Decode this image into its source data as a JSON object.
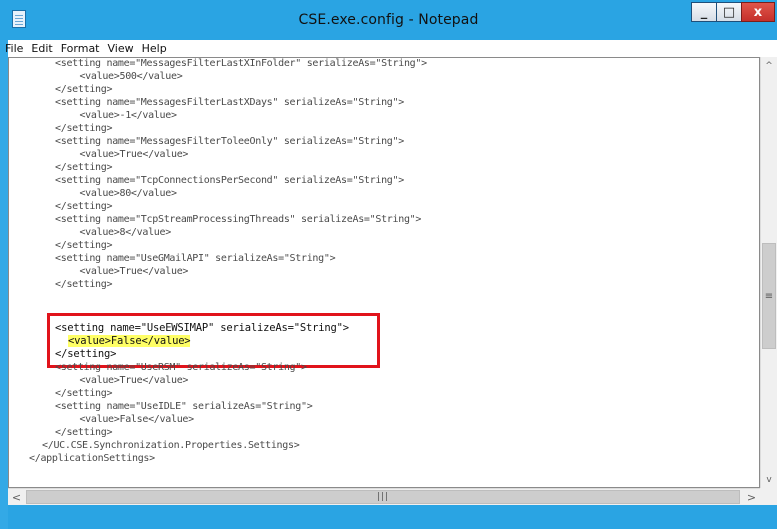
{
  "window": {
    "title": "CSE.exe.config - Notepad",
    "minimize_glyph": "_",
    "maximize_glyph": "□",
    "close_glyph": "x",
    "app_icon": "notepad-icon"
  },
  "menu": [
    {
      "label": "File"
    },
    {
      "label": "Edit"
    },
    {
      "label": "Format"
    },
    {
      "label": "View"
    },
    {
      "label": "Help"
    }
  ],
  "editor": {
    "lines": [
      "<setting name=\"MessagesFilterLastXInFolder\" serializeAs=\"String\">",
      "  <value>500</value>",
      "</setting>",
      "<setting name=\"MessagesFilterLastXDays\" serializeAs=\"String\">",
      "  <value>-1</value>",
      "</setting>",
      "<setting name=\"MessagesFilterToleeOnly\" serializeAs=\"String\">",
      "  <value>True</value>",
      "</setting>",
      "<setting name=\"TcpConnectionsPerSecond\" serializeAs=\"String\">",
      "  <value>80</value>",
      "</setting>",
      "<setting name=\"TcpStreamProcessingThreads\" serializeAs=\"String\">",
      "  <value>8</value>",
      "</setting>",
      "<setting name=\"UseGMailAPI\" serializeAs=\"String\">",
      "  <value>True</value>",
      "</setting>",
      "<setting name=\"UseEWSIMAP\" serializeAs=\"String\">",
      "  <value>False</value>",
      "</setting>",
      "<setting name=\"UseRSM\" serializeAs=\"String\">",
      "  <value>True</value>",
      "</setting>",
      "<setting name=\"UseIDLE\" serializeAs=\"String\">",
      "  <value>False</value>",
      "</setting>",
      "</UC.CSE.Synchronization.Properties.Settings>",
      "</applicationSettings>"
    ],
    "highlighted_value": "<value>False</value>",
    "highlight_color": "#ffff66",
    "callout_color": "#e1131b"
  },
  "scrollbars": {
    "up_glyph": "^",
    "down_glyph": "v",
    "left_glyph": "<",
    "right_glyph": ">",
    "vthumb_glyph": "≡",
    "hthumb_glyph": "|||"
  }
}
